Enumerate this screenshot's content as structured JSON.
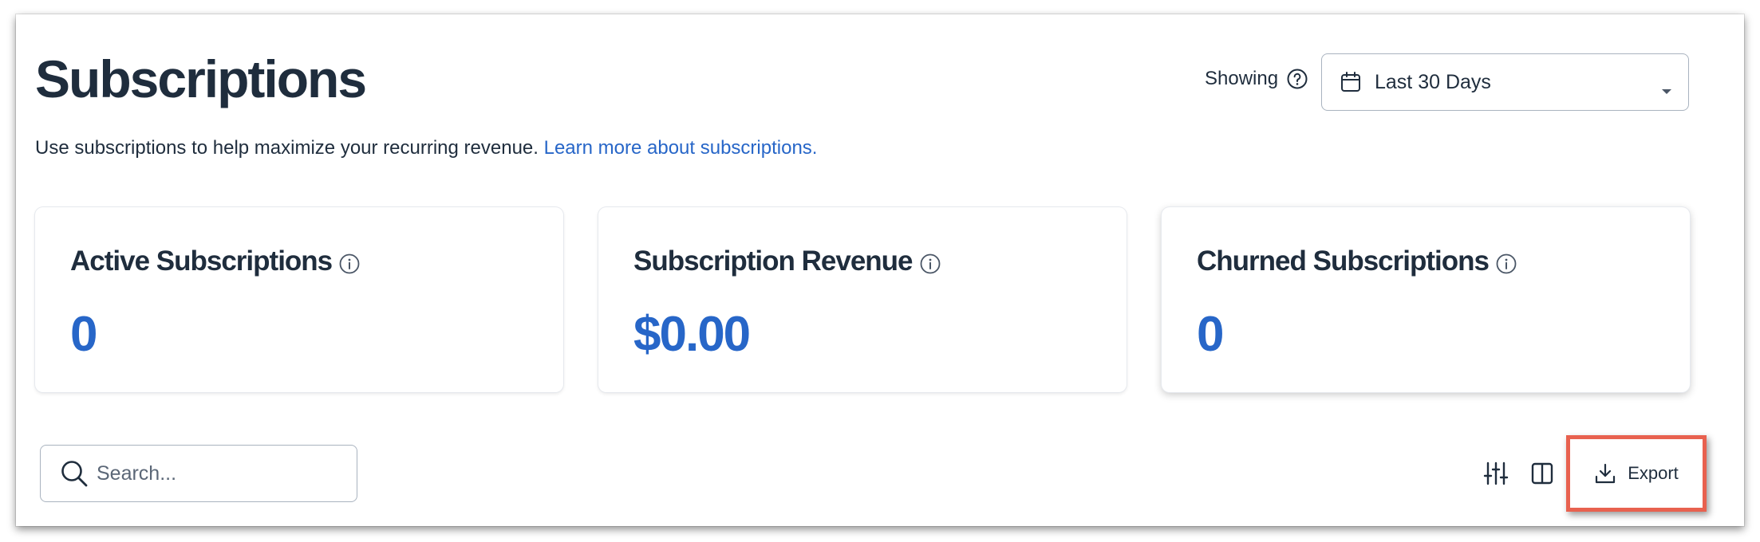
{
  "header": {
    "title": "Subscriptions",
    "description": "Use subscriptions to help maximize your recurring revenue.",
    "learn_more_link": "Learn more about subscriptions."
  },
  "date_filter": {
    "label": "Showing",
    "help_icon": "question-circle-icon",
    "selected_value": "Last 30 Days",
    "icon": "calendar-icon",
    "dropdown_icon": "caret-down-icon"
  },
  "stats": [
    {
      "label": "Active Subscriptions",
      "value": "0",
      "icon": "info-icon"
    },
    {
      "label": "Subscription Revenue",
      "value": "$0.00",
      "icon": "info-icon"
    },
    {
      "label": "Churned Subscriptions",
      "value": "0",
      "icon": "info-icon"
    }
  ],
  "toolbar": {
    "search_placeholder": "Search...",
    "search_value": "",
    "filter_icon": "sliders-icon",
    "columns_icon": "columns-icon",
    "export_label": "Export",
    "export_icon": "download-icon"
  },
  "colors": {
    "text_primary": "#1f2d3d",
    "accent_blue": "#2766c8",
    "border": "#a9b3bf",
    "highlight_red": "#e8614f"
  }
}
